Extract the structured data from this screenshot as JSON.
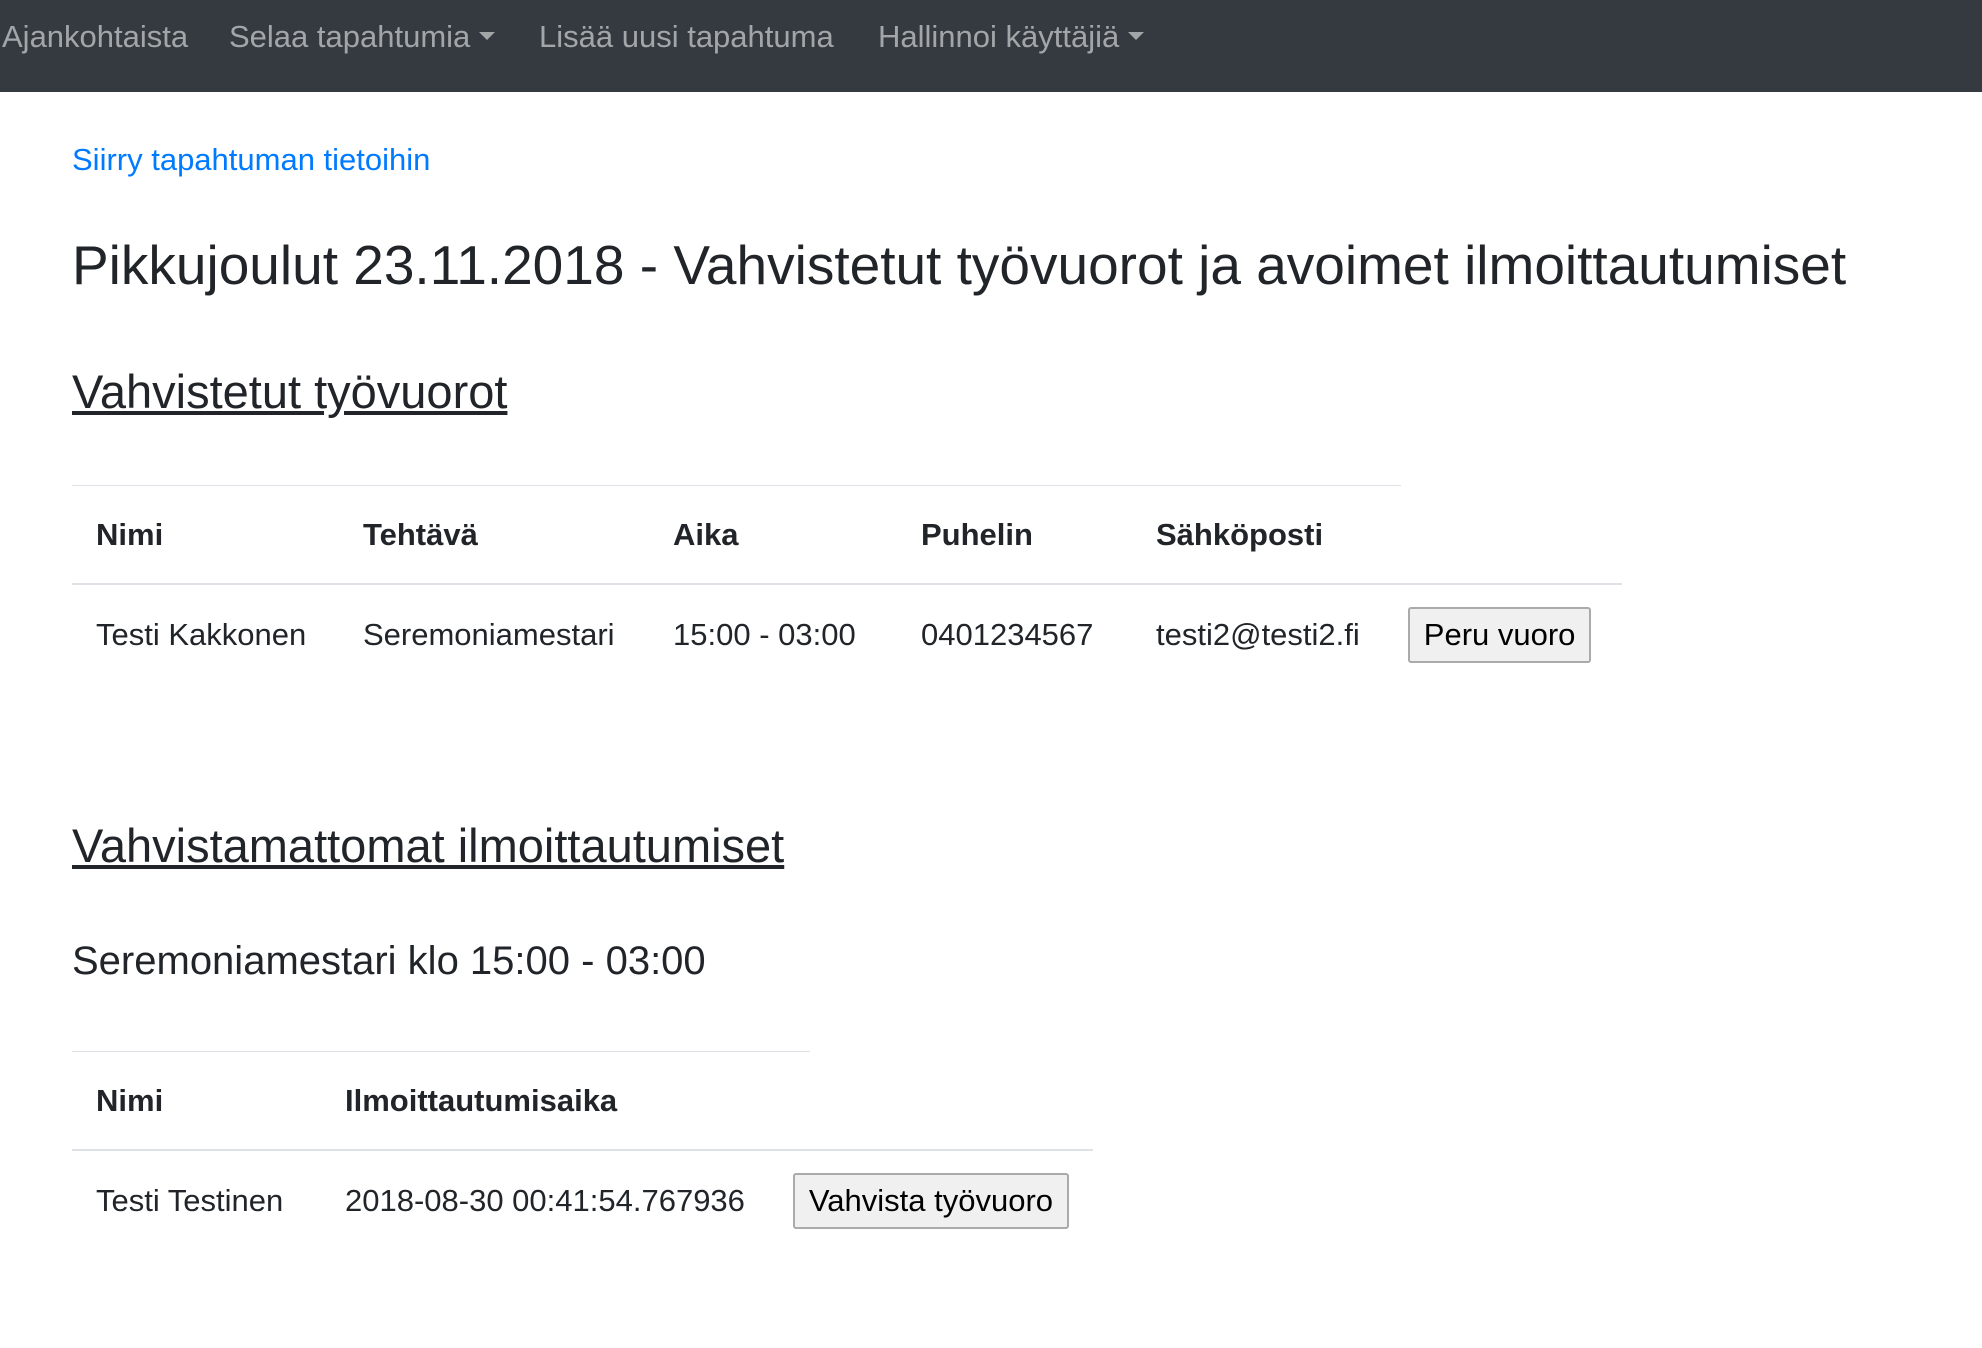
{
  "navbar": {
    "items": [
      {
        "label": "Ajankohtaista",
        "dropdown": false
      },
      {
        "label": "Selaa tapahtumia",
        "dropdown": true
      },
      {
        "label": "Lisää uusi tapahtuma",
        "dropdown": false
      },
      {
        "label": "Hallinnoi käyttäjiä",
        "dropdown": true
      }
    ]
  },
  "back_link": "Siirry tapahtuman tietoihin",
  "page_title": "Pikkujoulut 23.11.2018 - Vahvistetut työvuorot ja avoimet ilmoittautumiset",
  "confirmed": {
    "title": "Vahvistetut työvuorot",
    "headers": [
      "Nimi",
      "Tehtävä",
      "Aika",
      "Puhelin",
      "Sähköposti"
    ],
    "rows": [
      {
        "name": "Testi Kakkonen",
        "task": "Seremoniamestari",
        "time": "15:00 - 03:00",
        "phone": "0401234567",
        "email": "testi2@testi2.fi",
        "action": "Peru vuoro"
      }
    ]
  },
  "unconfirmed": {
    "title": "Vahvistamattomat ilmoittautumiset",
    "groups": [
      {
        "title": "Seremoniamestari klo 15:00 - 03:00",
        "headers": [
          "Nimi",
          "Ilmoittautumisaika"
        ],
        "rows": [
          {
            "name": "Testi Testinen",
            "signup_time": "2018-08-30 00:41:54.767936",
            "action": "Vahvista työvuoro"
          }
        ]
      }
    ]
  },
  "colors": {
    "navbar_bg": "#343a40",
    "nav_text": "rgba(255,255,255,0.55)",
    "link": "#007bff",
    "text": "#212529",
    "table_border": "#dee2e6"
  }
}
